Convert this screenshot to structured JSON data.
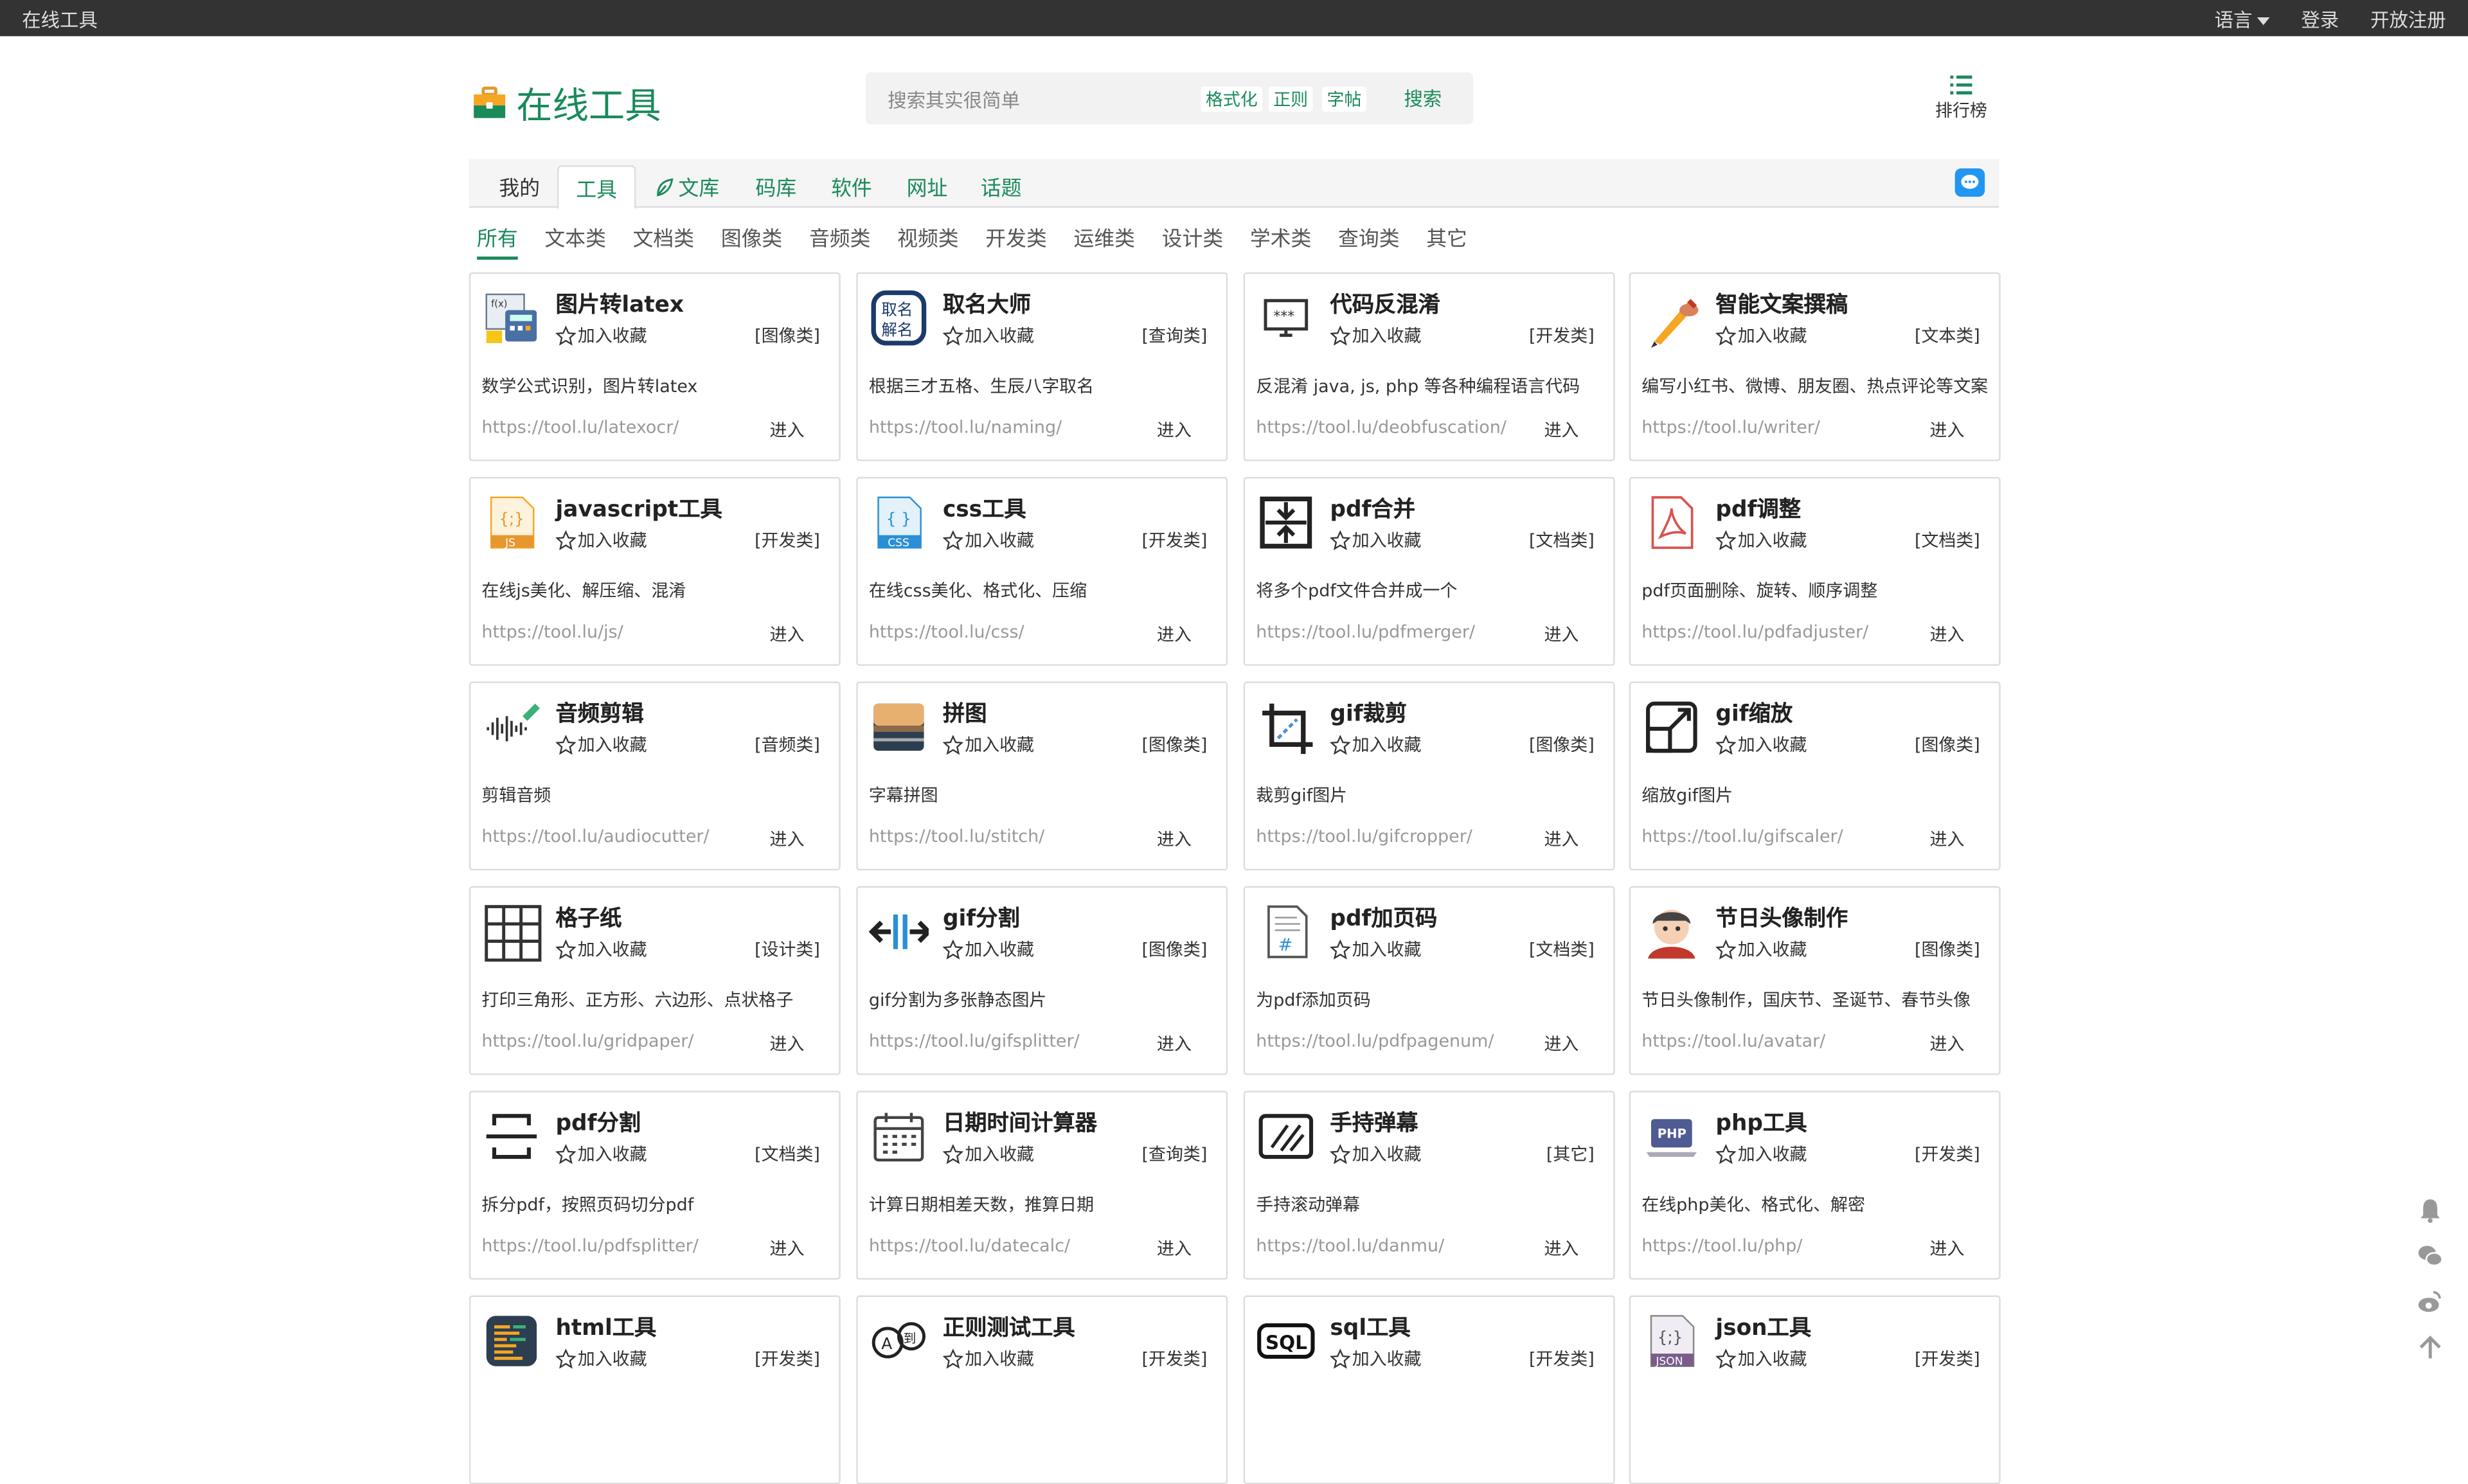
{
  "topbar": {
    "brand": "在线工具",
    "language": "语言",
    "login": "登录",
    "register": "开放注册"
  },
  "logo": {
    "text": "在线工具"
  },
  "search": {
    "placeholder": "搜索其实很简单",
    "tags": [
      "格式化",
      "正则",
      "字帖"
    ],
    "button": "搜索"
  },
  "rank": {
    "label": "排行榜"
  },
  "nav": {
    "tabs": [
      "我的",
      "工具",
      "文库",
      "码库",
      "软件",
      "网址",
      "话题"
    ],
    "active": "工具"
  },
  "categories": {
    "items": [
      "所有",
      "文本类",
      "文档类",
      "图像类",
      "音频类",
      "视频类",
      "开发类",
      "运维类",
      "设计类",
      "学术类",
      "查询类",
      "其它"
    ],
    "active": "所有"
  },
  "fav_label": "加入收藏",
  "enter_label": "进入",
  "cards": [
    {
      "name": "图片转latex",
      "cat": "[图像类]",
      "desc": "数学公式识别，图片转latex",
      "url": "https://tool.lu/latexocr/",
      "icon": "formula-image-icon"
    },
    {
      "name": "取名大师",
      "cat": "[查询类]",
      "desc": "根据三才五格、生辰八字取名",
      "url": "https://tool.lu/naming/",
      "icon": "naming-seal-icon"
    },
    {
      "name": "代码反混淆",
      "cat": "[开发类]",
      "desc": "反混淆 java, js, php 等各种编程语言代码",
      "url": "https://tool.lu/deobfuscation/",
      "icon": "monitor-password-icon"
    },
    {
      "name": "智能文案撰稿",
      "cat": "[文本类]",
      "desc": "编写小红书、微博、朋友圈、热点评论等文案",
      "url": "https://tool.lu/writer/",
      "icon": "pen-hand-icon"
    },
    {
      "name": "javascript工具",
      "cat": "[开发类]",
      "desc": "在线js美化、解压缩、混淆",
      "url": "https://tool.lu/js/",
      "icon": "js-file-icon"
    },
    {
      "name": "css工具",
      "cat": "[开发类]",
      "desc": "在线css美化、格式化、压缩",
      "url": "https://tool.lu/css/",
      "icon": "css-file-icon"
    },
    {
      "name": "pdf合并",
      "cat": "[文档类]",
      "desc": "将多个pdf文件合并成一个",
      "url": "https://tool.lu/pdfmerger/",
      "icon": "merge-icon"
    },
    {
      "name": "pdf调整",
      "cat": "[文档类]",
      "desc": "pdf页面删除、旋转、顺序调整",
      "url": "https://tool.lu/pdfadjuster/",
      "icon": "pdf-file-icon"
    },
    {
      "name": "音频剪辑",
      "cat": "[音频类]",
      "desc": "剪辑音频",
      "url": "https://tool.lu/audiocutter/",
      "icon": "waveform-icon"
    },
    {
      "name": "拼图",
      "cat": "[图像类]",
      "desc": "字幕拼图",
      "url": "https://tool.lu/stitch/",
      "icon": "photo-stitch-icon"
    },
    {
      "name": "gif裁剪",
      "cat": "[图像类]",
      "desc": "裁剪gif图片",
      "url": "https://tool.lu/gifcropper/",
      "icon": "crop-icon"
    },
    {
      "name": "gif缩放",
      "cat": "[图像类]",
      "desc": "缩放gif图片",
      "url": "https://tool.lu/gifscaler/",
      "icon": "scale-icon"
    },
    {
      "name": "格子纸",
      "cat": "[设计类]",
      "desc": "打印三角形、正方形、六边形、点状格子",
      "url": "https://tool.lu/gridpaper/",
      "icon": "grid-icon"
    },
    {
      "name": "gif分割",
      "cat": "[图像类]",
      "desc": "gif分割为多张静态图片",
      "url": "https://tool.lu/gifsplitter/",
      "icon": "split-arrows-icon"
    },
    {
      "name": "pdf加页码",
      "cat": "[文档类]",
      "desc": "为pdf添加页码",
      "url": "https://tool.lu/pdfpagenum/",
      "icon": "page-number-icon"
    },
    {
      "name": "节日头像制作",
      "cat": "[图像类]",
      "desc": "节日头像制作，国庆节、圣诞节、春节头像",
      "url": "https://tool.lu/avatar/",
      "icon": "avatar-icon"
    },
    {
      "name": "pdf分割",
      "cat": "[文档类]",
      "desc": "拆分pdf，按照页码切分pdf",
      "url": "https://tool.lu/pdfsplitter/",
      "icon": "page-split-icon"
    },
    {
      "name": "日期时间计算器",
      "cat": "[查询类]",
      "desc": "计算日期相差天数，推算日期",
      "url": "https://tool.lu/datecalc/",
      "icon": "calendar-icon"
    },
    {
      "name": "手持弹幕",
      "cat": "[其它]",
      "desc": "手持滚动弹幕",
      "url": "https://tool.lu/danmu/",
      "icon": "danmu-screen-icon"
    },
    {
      "name": "php工具",
      "cat": "[开发类]",
      "desc": "在线php美化、格式化、解密",
      "url": "https://tool.lu/php/",
      "icon": "php-laptop-icon"
    },
    {
      "name": "html工具",
      "cat": "[开发类]",
      "desc": "",
      "url": "",
      "icon": "html-code-icon"
    },
    {
      "name": "正则测试工具",
      "cat": "[开发类]",
      "desc": "",
      "url": "",
      "icon": "regex-bubble-icon"
    },
    {
      "name": "sql工具",
      "cat": "[开发类]",
      "desc": "",
      "url": "",
      "icon": "sql-icon"
    },
    {
      "name": "json工具",
      "cat": "[开发类]",
      "desc": "",
      "url": "",
      "icon": "json-file-icon"
    }
  ],
  "colors": {
    "brand": "#1a8a5a",
    "topbar": "#333333",
    "chat": "#2196f3"
  }
}
